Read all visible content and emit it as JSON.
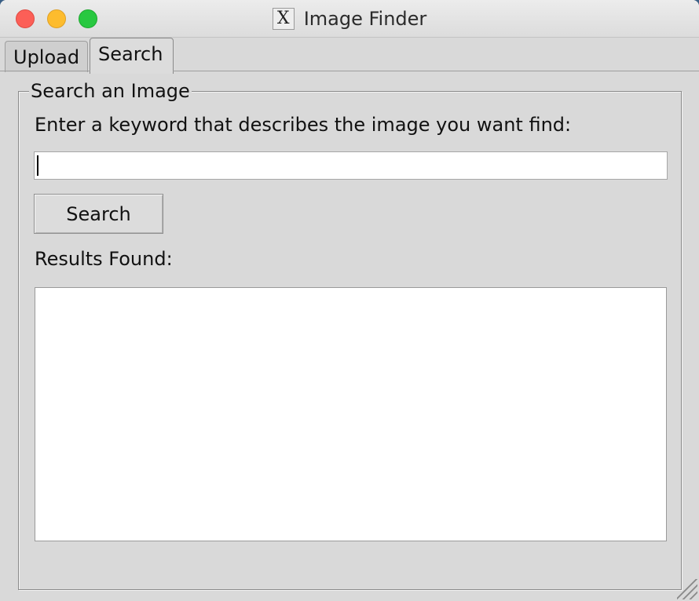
{
  "window": {
    "title": "Image Finder",
    "app_icon": "x11-icon"
  },
  "tabs": [
    {
      "label": "Upload",
      "selected": false
    },
    {
      "label": "Search",
      "selected": true
    }
  ],
  "search_group": {
    "legend": "Search an Image",
    "prompt": "Enter a keyword that describes the image you want find:",
    "input_value": "",
    "search_button_label": "Search",
    "results_label": "Results Found:",
    "results": []
  },
  "colors": {
    "window_bg": "#d9d9d9",
    "close": "#fc5f57",
    "minimize": "#fdbc2e",
    "maximize": "#28c840"
  }
}
